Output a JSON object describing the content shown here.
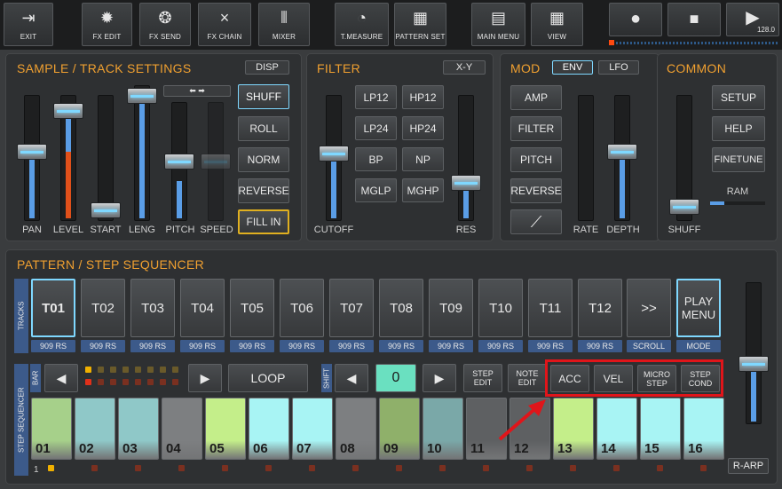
{
  "toolbar": {
    "exit": "EXIT",
    "fx_edit": "FX EDIT",
    "fx_send": "FX SEND",
    "fx_chain": "FX CHAIN",
    "mixer": "MIXER",
    "t_measure": "T.MEASURE",
    "pattern_set": "PATTERN SET",
    "main_menu": "MAIN MENU",
    "view": "VIEW",
    "tempo": "128.0"
  },
  "sample_track": {
    "title": "SAMPLE / TRACK SETTINGS",
    "disp": "DISP",
    "slider_labels": {
      "pan": "PAN",
      "level": "LEVEL",
      "start": "START",
      "leng": "LENG",
      "pitch": "PITCH",
      "speed": "SPEED"
    },
    "buttons": {
      "shuff": "SHUFF",
      "roll": "ROLL",
      "norm": "NORM",
      "reverse": "REVERSE",
      "fill_in": "FILL IN"
    }
  },
  "filter": {
    "title": "FILTER",
    "xy": "X-Y",
    "buttons": {
      "lp12": "LP12",
      "hp12": "HP12",
      "lp24": "LP24",
      "hp24": "HP24",
      "bp": "BP",
      "np": "NP",
      "mglp": "MGLP",
      "mghp": "MGHP"
    },
    "cutoff": "CUTOFF",
    "res": "RES"
  },
  "mod": {
    "title": "MOD",
    "env": "ENV",
    "lfo": "LFO",
    "buttons": {
      "amp": "AMP",
      "filter": "FILTER",
      "pitch": "PITCH",
      "reverse": "REVERSE"
    },
    "rate": "RATE",
    "depth": "DEPTH"
  },
  "common": {
    "title": "COMMON",
    "setup": "SETUP",
    "help": "HELP",
    "finetune": "FINETUNE",
    "ram": "RAM",
    "shuff": "SHUFF"
  },
  "sequencer": {
    "title": "PATTERN / STEP SEQUENCER",
    "tracks_label": "TRACKS",
    "tracks": [
      {
        "name": "T01",
        "sample": "909 RS"
      },
      {
        "name": "T02",
        "sample": "909 RS"
      },
      {
        "name": "T03",
        "sample": "909 RS"
      },
      {
        "name": "T04",
        "sample": "909 RS"
      },
      {
        "name": "T05",
        "sample": "909 RS"
      },
      {
        "name": "T06",
        "sample": "909 RS"
      },
      {
        "name": "T07",
        "sample": "909 RS"
      },
      {
        "name": "T08",
        "sample": "909 RS"
      },
      {
        "name": "T09",
        "sample": "909 RS"
      },
      {
        "name": "T10",
        "sample": "909 RS"
      },
      {
        "name": "T11",
        "sample": "909 RS"
      },
      {
        "name": "T12",
        "sample": "909 RS"
      }
    ],
    "scroll_btn": ">>",
    "scroll": "SCROLL",
    "play_menu": "PLAY MENU",
    "mode": "MODE",
    "step_seq_label": "STEP SEQUENCER",
    "bar": "BAR",
    "loop": "LOOP",
    "shift": "SHIFT",
    "shift_value": "0",
    "step_edit": "STEP EDIT",
    "note_edit": "NOTE EDIT",
    "acc": "ACC",
    "vel": "VEL",
    "micro_step": "MICRO STEP",
    "step_cond": "STEP COND",
    "steps": [
      "01",
      "02",
      "03",
      "04",
      "05",
      "06",
      "07",
      "08",
      "09",
      "10",
      "11",
      "12",
      "13",
      "14",
      "15",
      "16"
    ],
    "bar_number": "1",
    "r_arp": "R-ARP"
  },
  "colors": {
    "accent": "#f0a030",
    "highlight": "#e0151a",
    "selected": "#7fd8ff"
  }
}
